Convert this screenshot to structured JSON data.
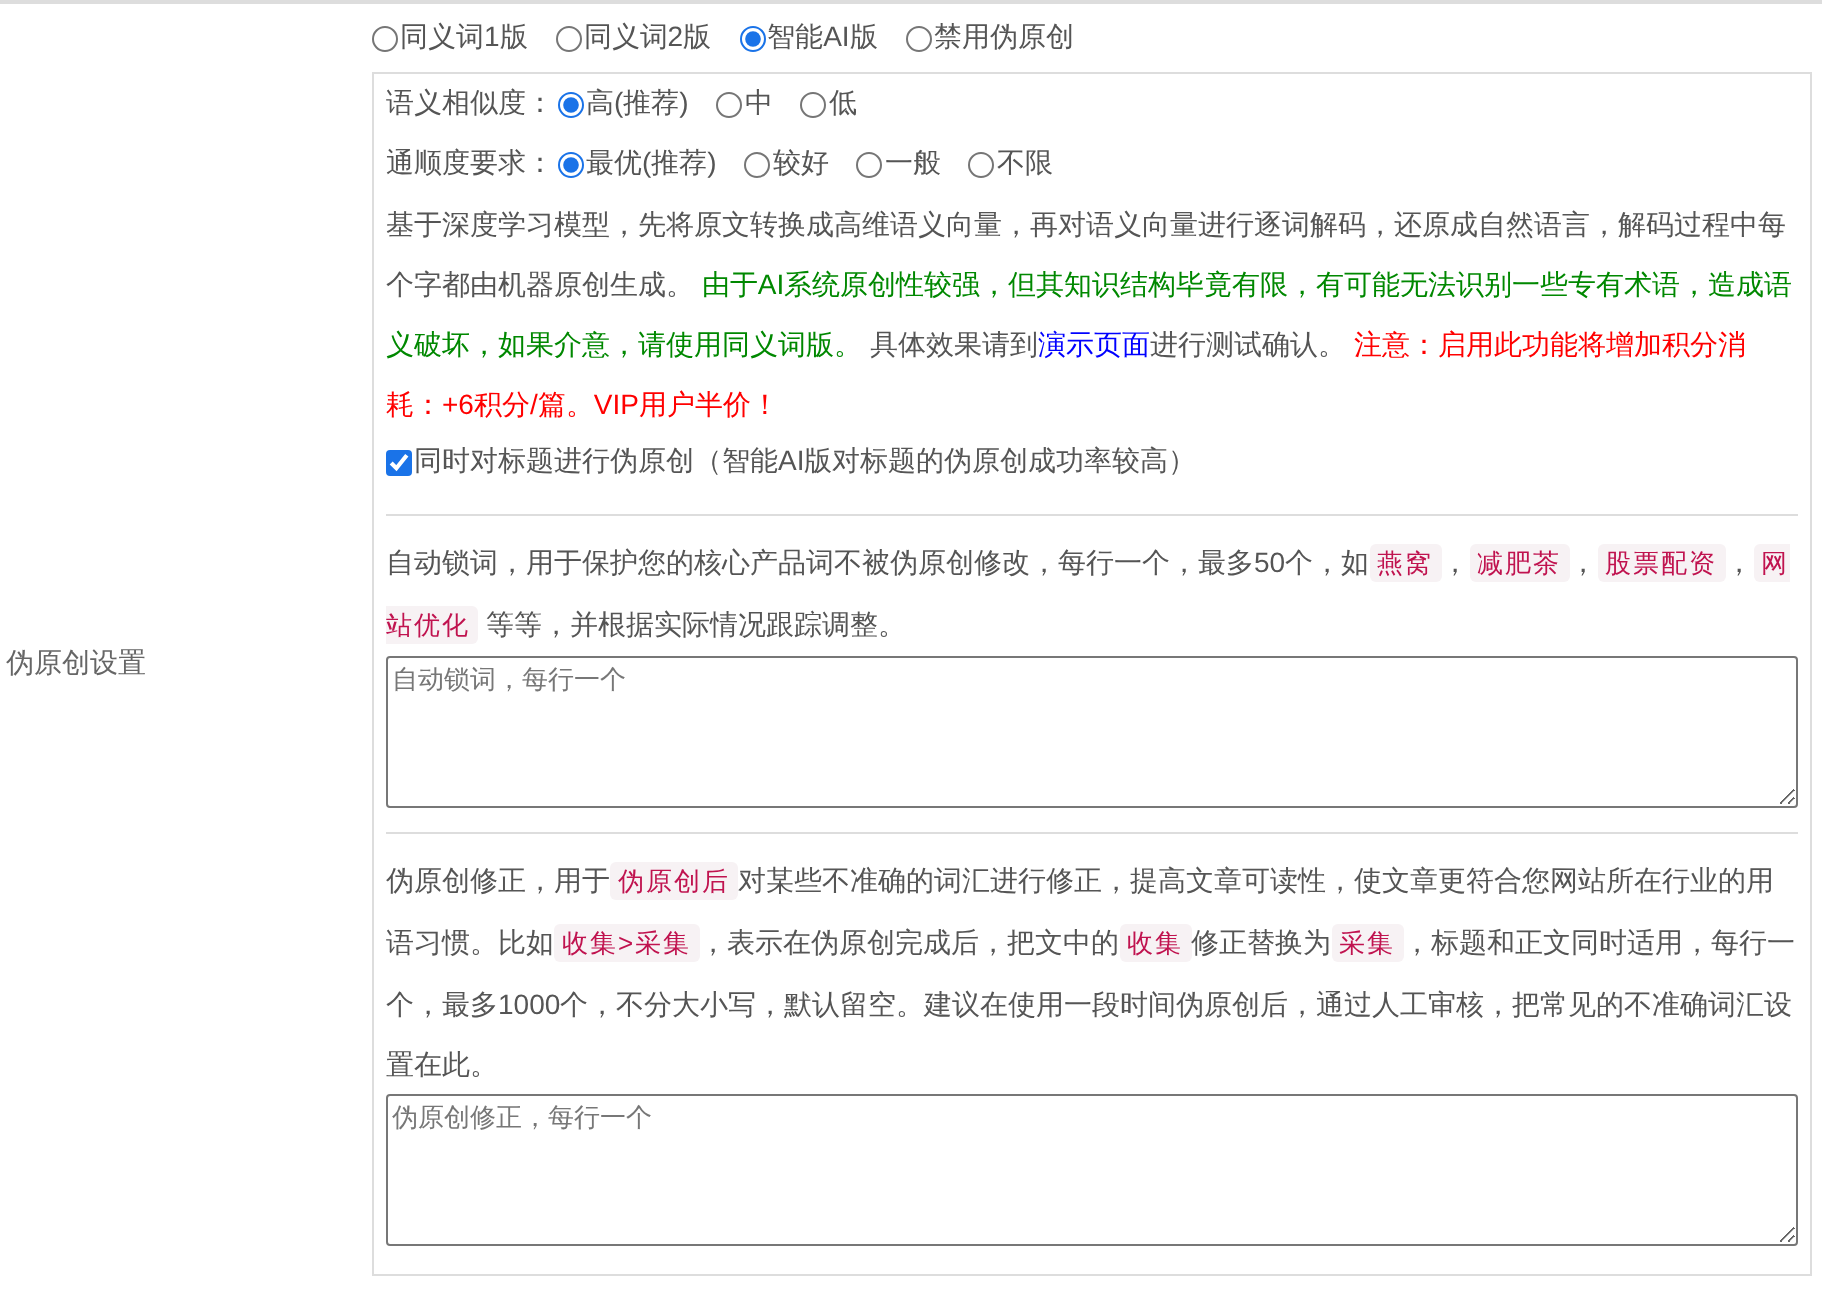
{
  "modes": [
    {
      "label": "同义词1版",
      "selected": false
    },
    {
      "label": "同义词2版",
      "selected": false
    },
    {
      "label": "智能AI版",
      "selected": true
    },
    {
      "label": "禁用伪原创",
      "selected": false
    }
  ],
  "side_label": "伪原创设置",
  "similarity": {
    "label": "语义相似度：",
    "options": [
      {
        "label": "高(推荐)",
        "selected": true
      },
      {
        "label": "中",
        "selected": false
      },
      {
        "label": "低",
        "selected": false
      }
    ]
  },
  "fluency": {
    "label": "通顺度要求：",
    "options": [
      {
        "label": "最优(推荐)",
        "selected": true
      },
      {
        "label": "较好",
        "selected": false
      },
      {
        "label": "一般",
        "selected": false
      },
      {
        "label": "不限",
        "selected": false
      }
    ]
  },
  "ai_note": [
    {
      "kind": "plain",
      "text": "基于深度学习模型，先将原文转换成高维语义向量，再对语义向量进行逐词解码，还原成自然语言，解码过程中每个字都由机器原创生成。 "
    },
    {
      "kind": "notice",
      "text": "由于AI系统原创性较强，但其知识结构毕竟有限，有可能无法识别一些专有术语，造成语义破坏，如果介意，请使用同义词版。"
    },
    {
      "kind": "plain",
      "text": " 具体效果请到"
    },
    {
      "kind": "link",
      "text": "演示页面"
    },
    {
      "kind": "plain",
      "text": "进行测试确认。 "
    },
    {
      "kind": "warning",
      "text": "注意：启用此功能将增加积分消耗：+6积分/篇。VIP用户半价！"
    }
  ],
  "title_option": {
    "label": "同时对标题进行伪原创（智能AI版对标题的伪原创成功率较高）",
    "checked": true
  },
  "lock_words": {
    "description": [
      {
        "kind": "plain",
        "text": "自动锁词，用于保护您的核心产品词不被伪原创修改，每行一个，最多50个，如"
      },
      {
        "kind": "tag",
        "text": "燕窝"
      },
      {
        "kind": "plain",
        "text": "，"
      },
      {
        "kind": "tag",
        "text": "减肥茶"
      },
      {
        "kind": "plain",
        "text": "，"
      },
      {
        "kind": "tag",
        "text": "股票配资"
      },
      {
        "kind": "plain",
        "text": "，"
      },
      {
        "kind": "tag",
        "text": "网站优化"
      },
      {
        "kind": "plain",
        "text": " 等等，并根据实际情况跟踪调整。"
      }
    ],
    "placeholder": "自动锁词，每行一个"
  },
  "correction": {
    "description": [
      {
        "kind": "plain",
        "text": "伪原创修正，用于"
      },
      {
        "kind": "tag",
        "text": "伪原创后"
      },
      {
        "kind": "plain",
        "text": "对某些不准确的词汇进行修正，提高文章可读性，使文章更符合您网站所在行业的用语习惯。比如"
      },
      {
        "kind": "tag",
        "text": "收集>采集"
      },
      {
        "kind": "plain",
        "text": "，表示在伪原创完成后，把文中的"
      },
      {
        "kind": "tag",
        "text": "收集"
      },
      {
        "kind": "plain",
        "text": "修正替换为"
      },
      {
        "kind": "tag",
        "text": "采集"
      },
      {
        "kind": "plain",
        "text": "，标题和正文同时适用，每行一个，最多1000个，不分大小写，默认留空。建议在使用一段时间伪原创后，通过人工审核，把常见的不准确词汇设置在此。"
      }
    ],
    "placeholder": "伪原创修正，每行一个"
  }
}
